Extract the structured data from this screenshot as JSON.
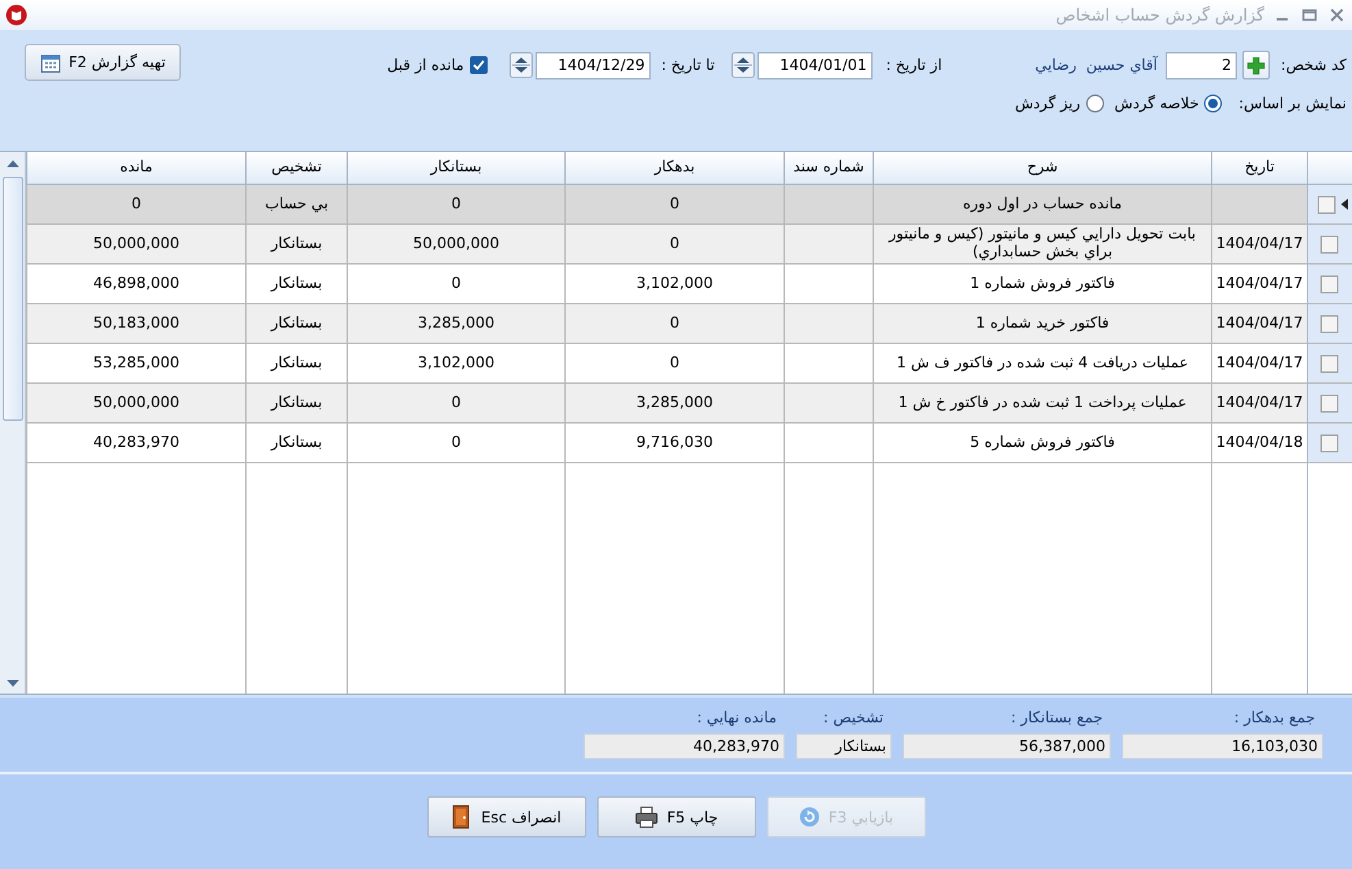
{
  "window": {
    "title": "گزارش گردش حساب اشخاص"
  },
  "filters": {
    "person_code_label": "کد شخص:",
    "person_code": "2",
    "person_name": "آقاي حسين  رضايي",
    "from_label": "از تاريخ :",
    "from_date": "1404/01/01",
    "to_label": "تا تاريخ :",
    "to_date": "1404/12/29",
    "carry_over": {
      "label": "مانده از قبل",
      "checked": true
    },
    "prepare_button": "تهيه گزارش F2",
    "view_label": "نمايش بر اساس:",
    "view_options": [
      {
        "label": "خلاصه گردش",
        "selected": true
      },
      {
        "label": "ريز گردش",
        "selected": false
      }
    ]
  },
  "table": {
    "columns": [
      "تاريخ",
      "شرح",
      "شماره سند",
      "بدهکار",
      "بستانکار",
      "تشخيص",
      "مانده"
    ],
    "rows": [
      {
        "selected": true,
        "checked": false,
        "description": "مانده حساب در اول دوره",
        "debit": "0",
        "credit": "0",
        "status": "بي حساب",
        "balance": "0"
      },
      {
        "selected": false,
        "checked": false,
        "date": "1404/04/17",
        "description": "بابت تحويل دارايي کيس و مانيتور (کيس و مانيتور براي بخش حسابداري)",
        "debit": "0",
        "credit": "50,000,000",
        "status": "بستانکار",
        "balance": "50,000,000"
      },
      {
        "selected": false,
        "checked": false,
        "date": "1404/04/17",
        "description": "فاکتور فروش شماره 1",
        "debit": "3,102,000",
        "credit": "0",
        "status": "بستانکار",
        "balance": "46,898,000"
      },
      {
        "selected": false,
        "checked": false,
        "date": "1404/04/17",
        "description": "فاکتور خريد شماره 1",
        "debit": "0",
        "credit": "3,285,000",
        "status": "بستانکار",
        "balance": "50,183,000"
      },
      {
        "selected": false,
        "checked": false,
        "date": "1404/04/17",
        "description": "عمليات دريافت 4 ثبت شده در فاکتور ف ش 1",
        "debit": "0",
        "credit": "3,102,000",
        "status": "بستانکار",
        "balance": "53,285,000"
      },
      {
        "selected": false,
        "checked": false,
        "date": "1404/04/17",
        "description": "عمليات پرداخت 1 ثبت شده در فاکتور خ ش 1",
        "debit": "3,285,000",
        "credit": "0",
        "status": "بستانکار",
        "balance": "50,000,000"
      },
      {
        "selected": false,
        "checked": false,
        "date": "1404/04/18",
        "description": "فاکتور فروش شماره 5",
        "debit": "9,716,030",
        "credit": "0",
        "status": "بستانکار",
        "balance": "40,283,970"
      }
    ]
  },
  "summary": [
    {
      "label": "جمع بدهکار :",
      "value": "16,103,030"
    },
    {
      "label": "جمع بستانکار :",
      "value": "56,387,000"
    },
    {
      "label": "تشخيص :",
      "value": "بستانکار"
    },
    {
      "label": "مانده نهايي :",
      "value": "40,283,970"
    }
  ],
  "buttons": [
    {
      "kind": "refresh",
      "label": "بازيابي F3",
      "disabled": true
    },
    {
      "kind": "print",
      "label": "چاپ F5",
      "disabled": false
    },
    {
      "kind": "exit",
      "label": "انصراف Esc",
      "disabled": false
    }
  ]
}
